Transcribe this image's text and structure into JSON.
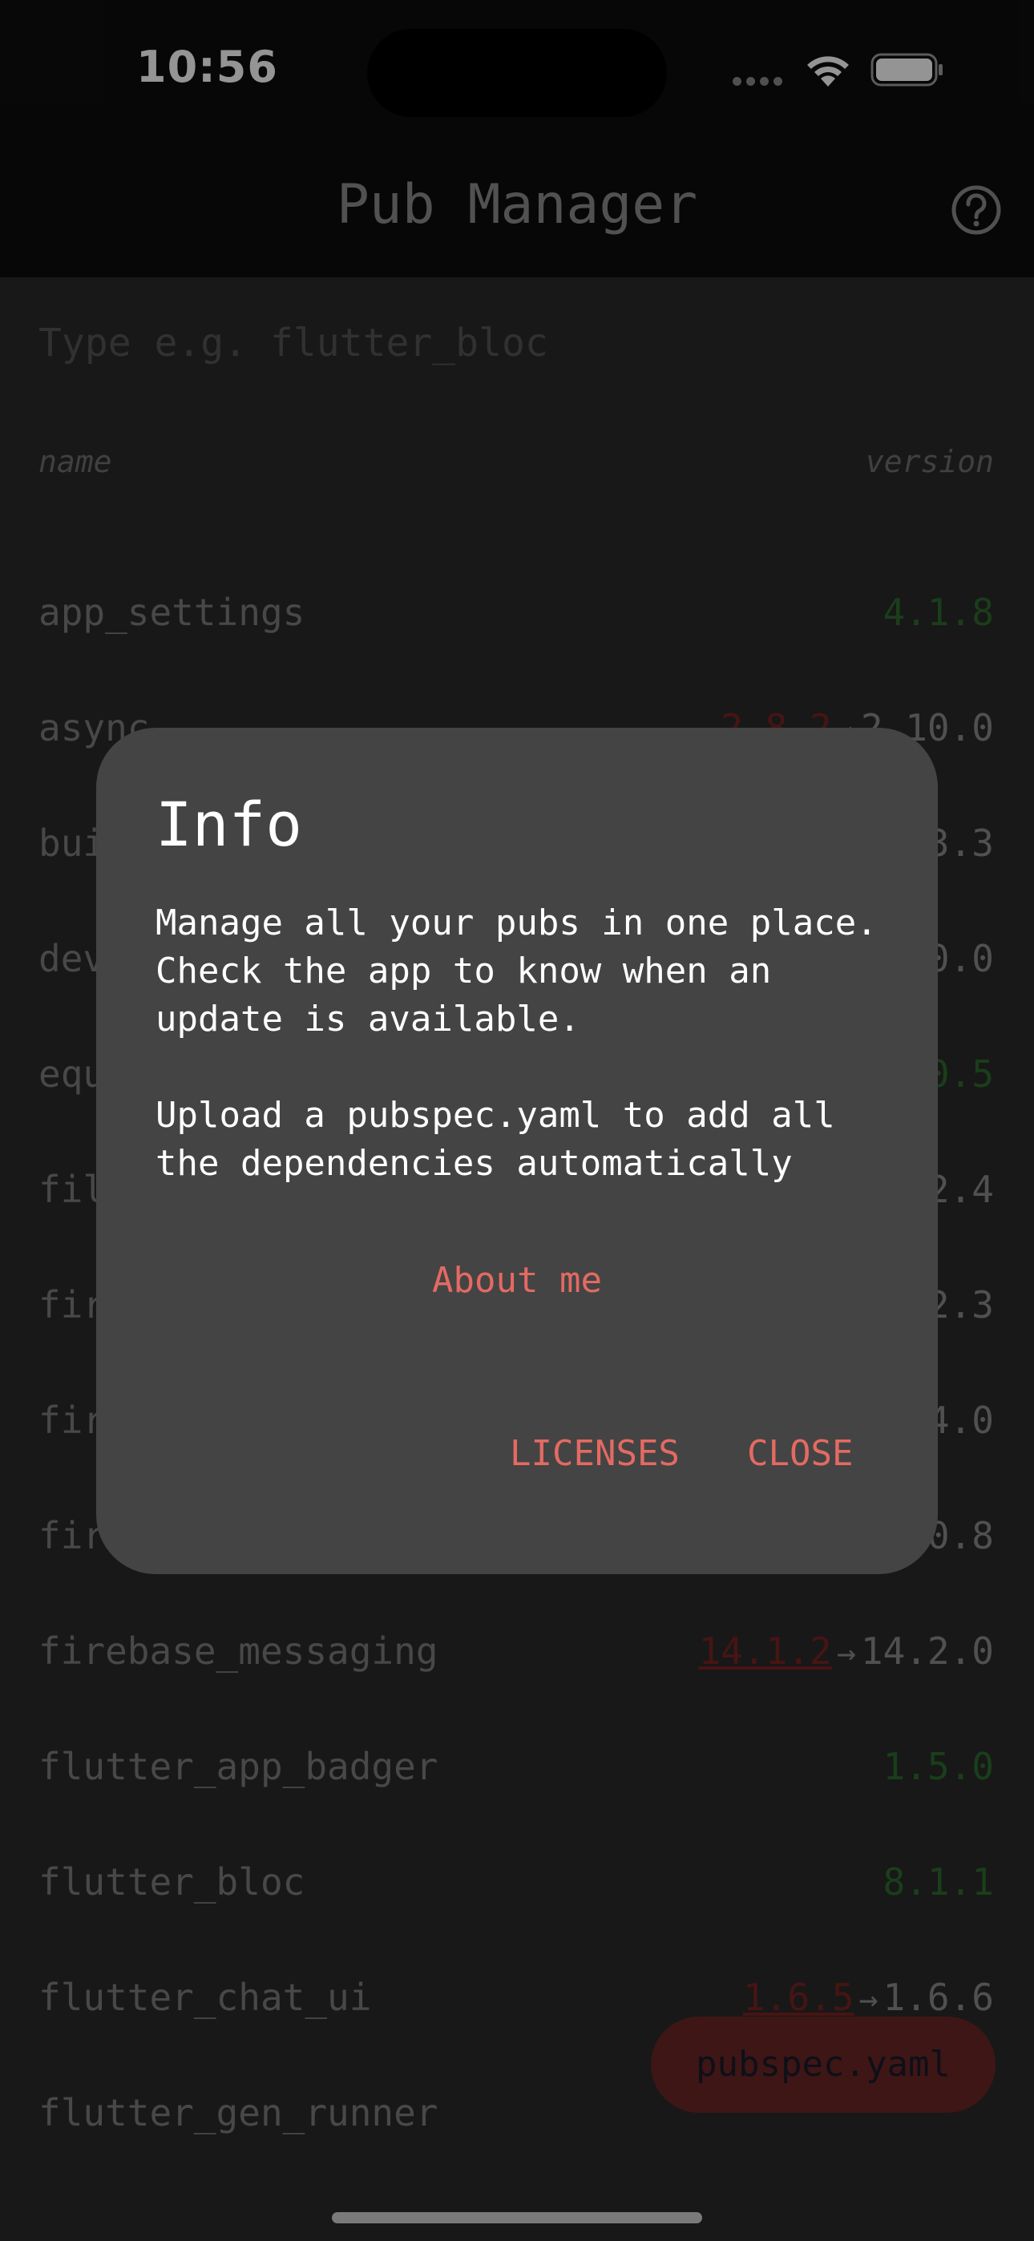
{
  "status_bar": {
    "time": "10:56"
  },
  "app_bar": {
    "title": "Pub Manager",
    "help_icon": "help-circle-icon"
  },
  "search": {
    "placeholder": "Type e.g. flutter_bloc"
  },
  "table": {
    "header_name": "name",
    "header_version": "version",
    "rows": [
      {
        "name": "app_settings",
        "current": "4.1.8",
        "outdated": false
      },
      {
        "name": "async",
        "current": "2.8.2",
        "latest": "2.10.0",
        "outdated": true
      },
      {
        "name": "bui",
        "tail": "3.3"
      },
      {
        "name": "dev",
        "tail": "0.0"
      },
      {
        "name": "equ",
        "tail": "0.5",
        "ok": true
      },
      {
        "name": "fil",
        "tail": "2.4"
      },
      {
        "name": "fir",
        "tail": "2.3"
      },
      {
        "name": "fir",
        "tail": "4.0"
      },
      {
        "name": "fir",
        "tail": "0.8"
      },
      {
        "name": "firebase_messaging",
        "current": "14.1.2",
        "latest": "14.2.0",
        "outdated": true
      },
      {
        "name": "flutter_app_badger",
        "current": "1.5.0",
        "outdated": false
      },
      {
        "name": "flutter_bloc",
        "current": "8.1.1",
        "outdated": false
      },
      {
        "name": "flutter_chat_ui",
        "current": "1.6.5",
        "latest": "1.6.6",
        "outdated": true
      },
      {
        "name": "flutter_gen_runner"
      }
    ]
  },
  "fab": {
    "label": "pubspec.yaml"
  },
  "dialog": {
    "title": "Info",
    "paragraph1": "Manage all your pubs in one place. Check the app to know when an update is available.",
    "paragraph2": "Upload a pubspec.yaml to add all the dependencies automatically",
    "about_link": "About me",
    "licenses_button": "LICENSES",
    "close_button": "CLOSE"
  },
  "colors": {
    "accent": "#e46a62",
    "up_to_date": "#2e6b2e",
    "outdated": "#7a2424",
    "dialog_bg": "#444444"
  }
}
